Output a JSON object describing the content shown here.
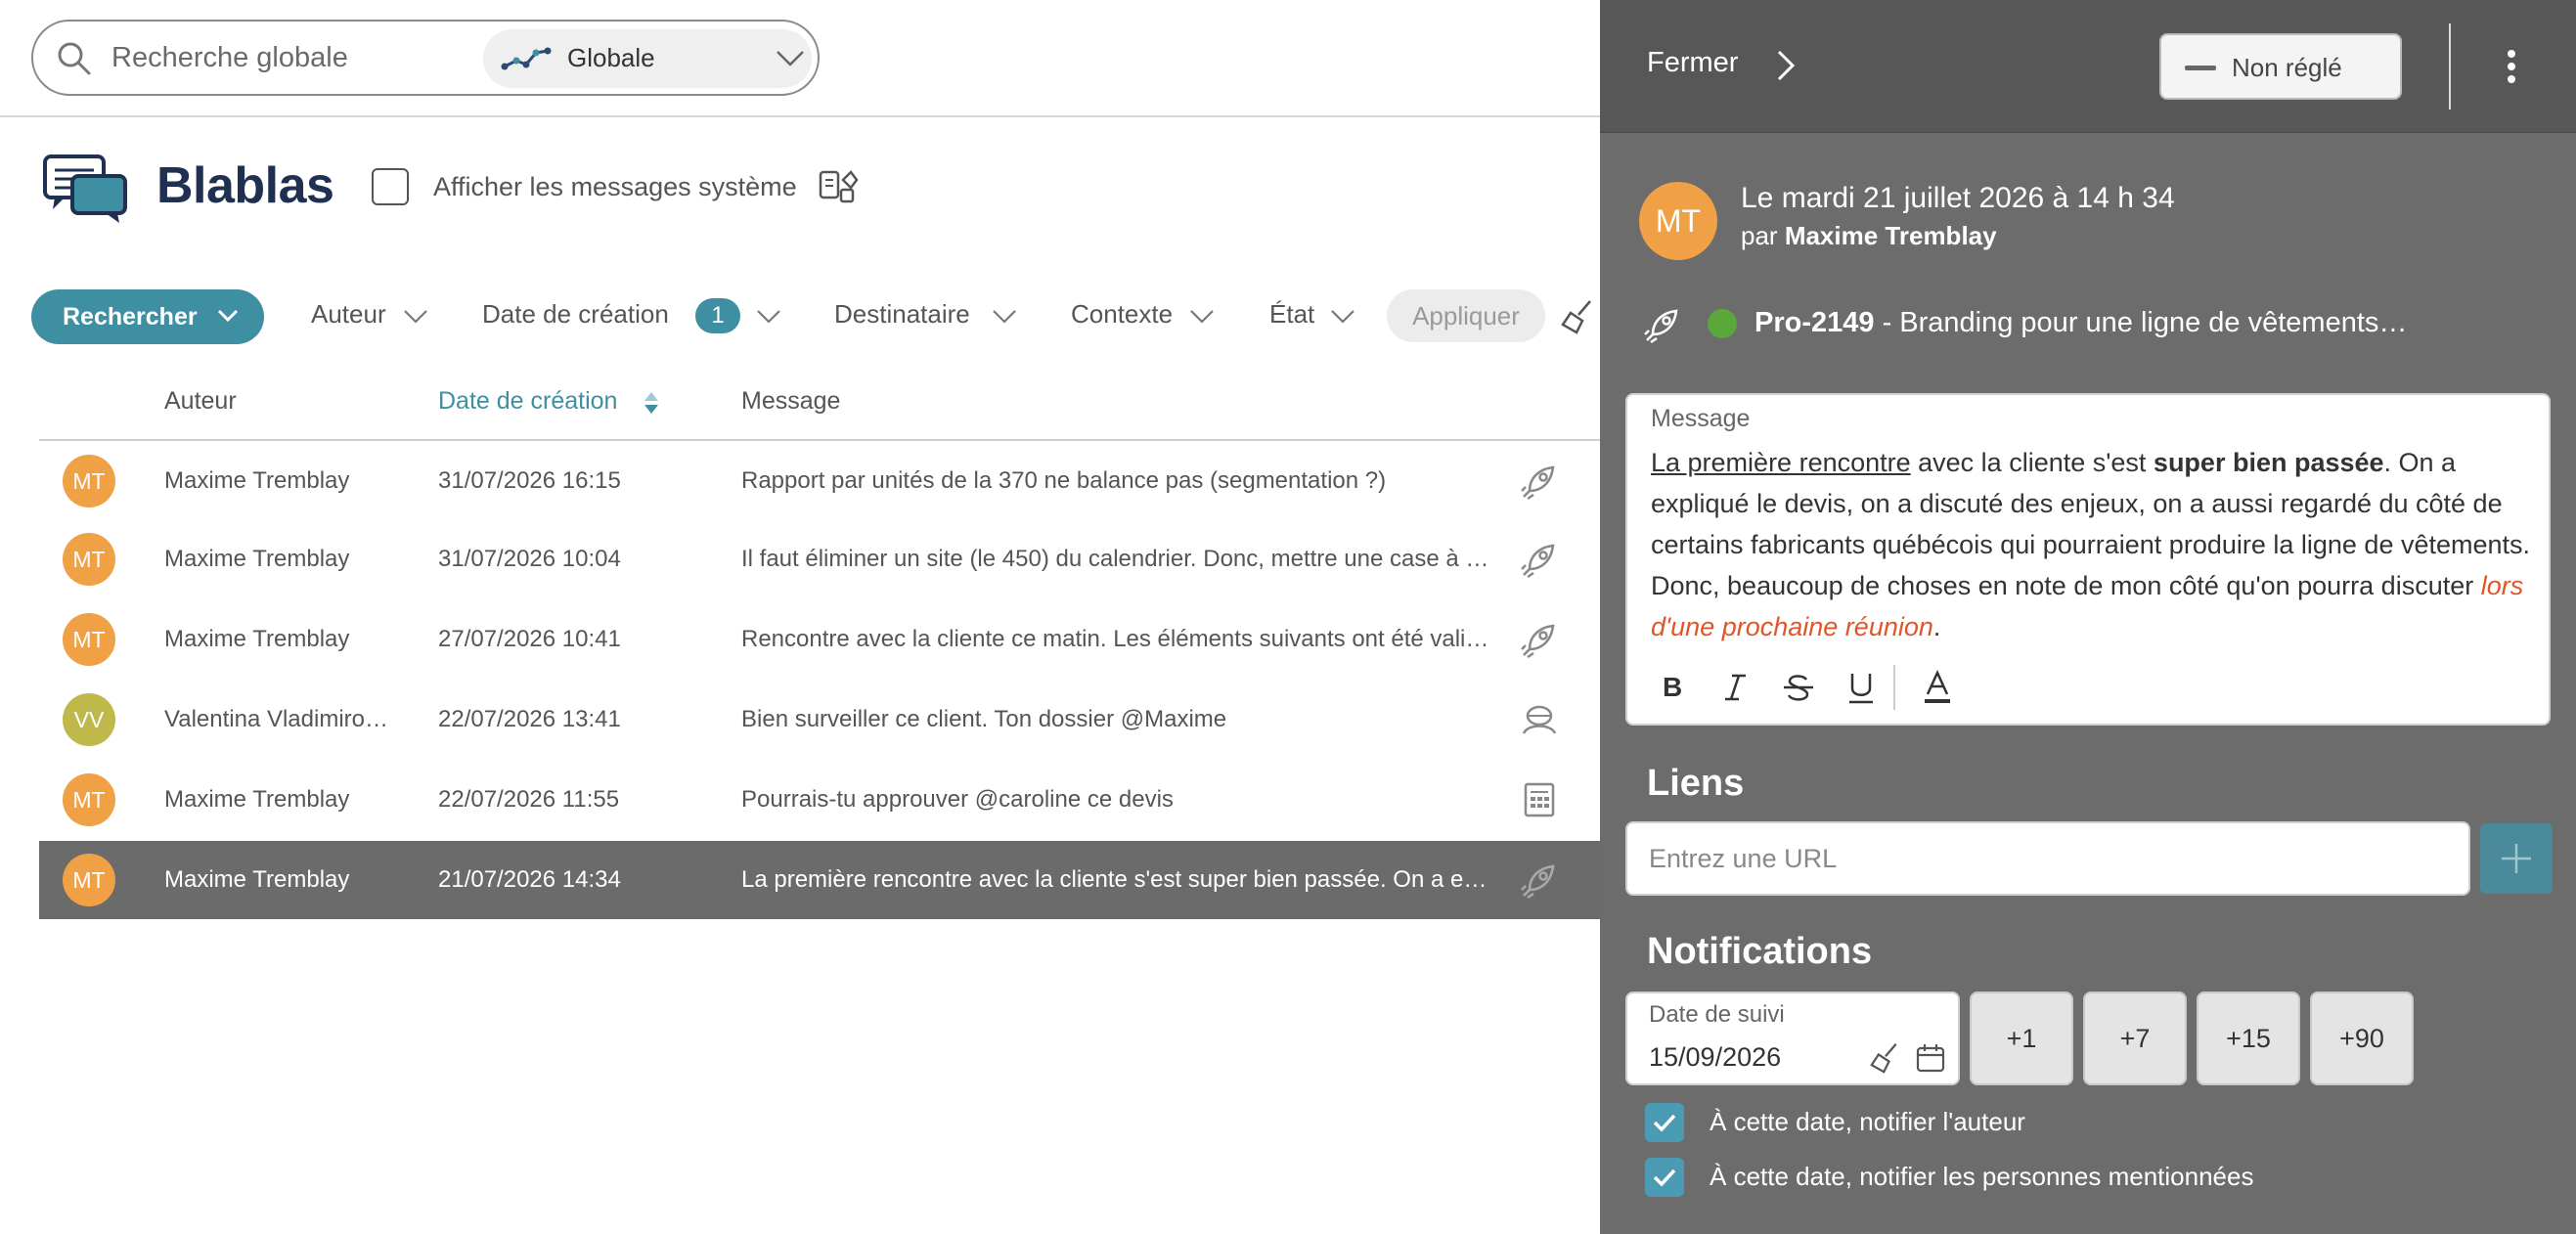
{
  "search": {
    "placeholder": "Recherche globale",
    "scope": "Globale"
  },
  "header": {
    "title": "Blablas",
    "system_messages_label": "Afficher les messages système"
  },
  "filters": {
    "search_button": "Rechercher",
    "author": "Auteur",
    "creation_date": "Date de création",
    "creation_date_count": "1",
    "recipient": "Destinataire",
    "context": "Contexte",
    "state": "État",
    "apply": "Appliquer"
  },
  "table": {
    "columns": {
      "author": "Auteur",
      "date": "Date de création",
      "message": "Message"
    },
    "rows": [
      {
        "initials": "MT",
        "avatar_color": "#f0a045",
        "author": "Maxime Tremblay",
        "date": "31/07/2026 16:15",
        "message": "Rapport par unités de la 370 ne balance pas (segmentation ?)",
        "context_icon": "rocket-icon"
      },
      {
        "initials": "MT",
        "avatar_color": "#f0a045",
        "author": "Maxime Tremblay",
        "date": "31/07/2026 10:04",
        "message": "Il faut éliminer un site (le 450) du calendrier. Donc, mettre une case à …",
        "context_icon": "rocket-icon"
      },
      {
        "initials": "MT",
        "avatar_color": "#f0a045",
        "author": "Maxime Tremblay",
        "date": "27/07/2026 10:41",
        "message": "Rencontre avec la cliente ce matin. Les éléments suivants ont été vali…",
        "context_icon": "rocket-icon"
      },
      {
        "initials": "VV",
        "avatar_color": "#bfb84a",
        "author": "Valentina Vladimiro…",
        "date": "22/07/2026 13:41",
        "message": "Bien surveiller ce client. Ton dossier @Maxime",
        "context_icon": "client-icon"
      },
      {
        "initials": "MT",
        "avatar_color": "#f0a045",
        "author": "Maxime Tremblay",
        "date": "22/07/2026 11:55",
        "message": "Pourrais-tu approuver @caroline ce devis",
        "context_icon": "quote-icon"
      },
      {
        "initials": "MT",
        "avatar_color": "#f0a045",
        "author": "Maxime Tremblay",
        "date": "21/07/2026 14:34",
        "message": "La première rencontre avec la cliente s'est super bien passée. On a e…",
        "context_icon": "rocket-icon",
        "selected": true
      }
    ]
  },
  "panel": {
    "close_label": "Fermer",
    "status": "Non réglé",
    "avatar_initials": "MT",
    "date_line": "Le mardi 21 juillet 2026 à 14 h 34",
    "by_prefix": "par",
    "by_author": "Maxime Tremblay",
    "project_code": "Pro-2149",
    "project_title": " - Branding pour une ligne de vêtements…",
    "status_dot_color": "#5aa83b",
    "message_label": "Message",
    "message": {
      "p1": "La première rencontre",
      "p2": " avec la cliente s'est ",
      "p3": "super bien passée",
      "p4": ". On a expliqué le devis, on a discuté des enjeux, on a aussi regardé du côté de certains fabricants québécois qui pourraient produire la ligne de vêtements. Donc, beaucoup de choses en note de mon côté qu'on pourra discuter ",
      "p5": "lors d'une prochaine réunion",
      "p6": "."
    },
    "links_title": "Liens",
    "url_placeholder": "Entrez une URL",
    "notifications_title": "Notifications",
    "followup_label": "Date de suivi",
    "followup_value": "15/09/2026",
    "quick_days": [
      "+1",
      "+7",
      "+15",
      "+90"
    ],
    "notify_author": "À cette date, notifier l'auteur",
    "notify_mentioned": "À cette date, notifier les personnes mentionnées"
  },
  "colors": {
    "accent": "#3f8fa3",
    "brand_title": "#1f3050",
    "panel_bg": "#6c6c6c",
    "selected_row": "#6b6b6b",
    "highlight_text": "#e0552a"
  }
}
